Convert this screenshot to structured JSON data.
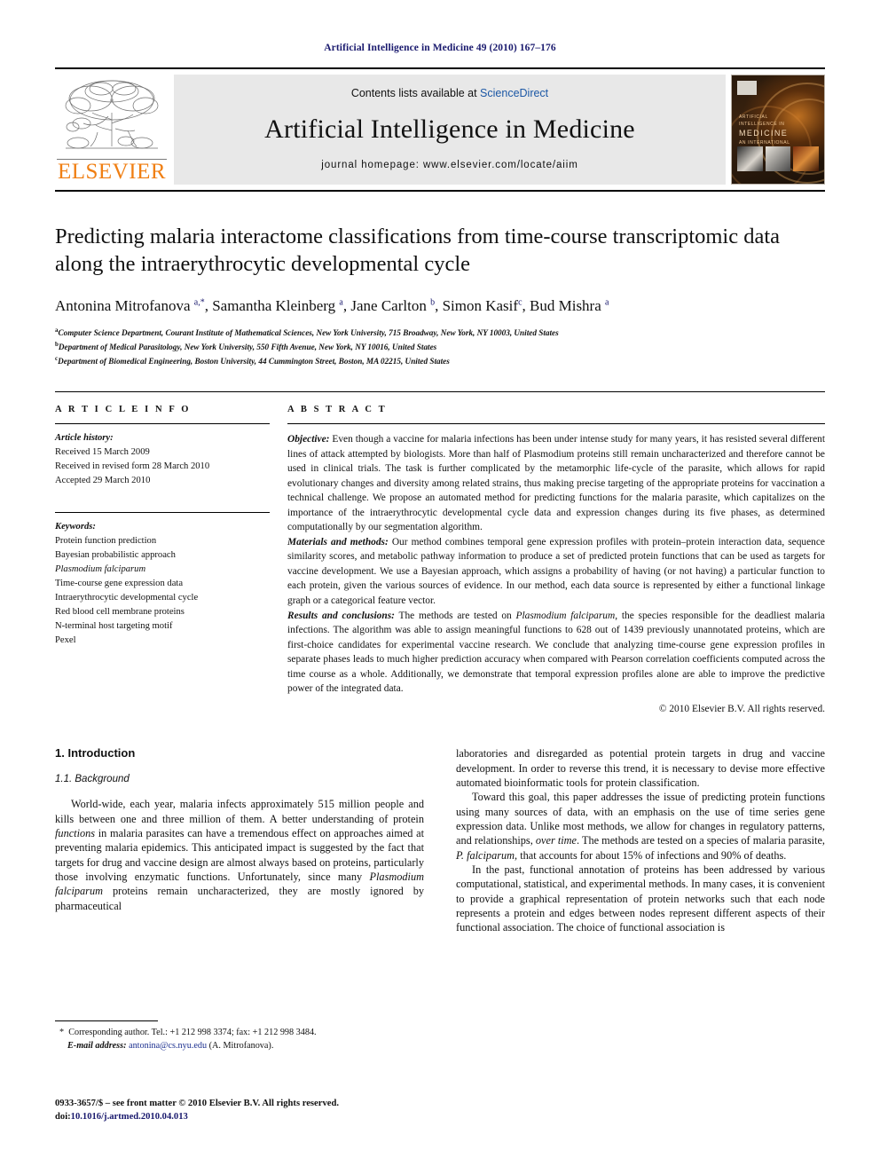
{
  "running_head": "Artificial Intelligence in Medicine 49 (2010) 167–176",
  "masthead": {
    "contents_prefix": "Contents lists available at ",
    "sciencedirect": "ScienceDirect",
    "journal_name": "Artificial Intelligence in Medicine",
    "homepage": "journal homepage: www.elsevier.com/locate/aiim",
    "publisher_wordmark": "ELSEVIER",
    "cover_title_small": "ARTIFICIAL INTELLIGENCE IN",
    "cover_title_large": "MEDICINE",
    "cover_subtitle": "AN INTERNATIONAL JOURNAL"
  },
  "article": {
    "title": "Predicting malaria interactome classifications from time-course transcriptomic data along the intraerythrocytic developmental cycle",
    "authors_html": "Antonina Mitrofanova <sup>a,*</sup>, Samantha Kleinberg <sup>a</sup>, Jane Carlton <sup>b</sup>, Simon Kasif<sup>c</sup>, Bud Mishra <sup>a</sup>",
    "affiliations": [
      "Computer Science Department, Courant Institute of Mathematical Sciences, New York University, 715 Broadway, New York, NY 10003, United States",
      "Department of Medical Parasitology, New York University, 550 Fifth Avenue, New York, NY 10016, United States",
      "Department of Biomedical Engineering, Boston University, 44 Cummington Street, Boston, MA 02215, United States"
    ],
    "affiliation_marks": [
      "a",
      "b",
      "c"
    ]
  },
  "article_info": {
    "heading": "A R T I C L E  I N F O",
    "history_label": "Article history:",
    "history": [
      "Received 15 March 2009",
      "Received in revised form 28 March 2010",
      "Accepted 29 March 2010"
    ],
    "keywords_label": "Keywords:",
    "keywords": [
      "Protein function prediction",
      "Bayesian probabilistic approach",
      "Plasmodium falciparum",
      "Time-course gene expression data",
      "Intraerythrocytic developmental cycle",
      "Red blood cell membrane proteins",
      "N-terminal host targeting motif",
      "Pexel"
    ],
    "keyword_italic_index": 2
  },
  "abstract": {
    "heading": "A B S T R A C T",
    "objective_label": "Objective:",
    "objective_text": "Even though a vaccine for malaria infections has been under intense study for many years, it has resisted several different lines of attack attempted by biologists. More than half of Plasmodium proteins still remain uncharacterized and therefore cannot be used in clinical trials. The task is further complicated by the metamorphic life-cycle of the parasite, which allows for rapid evolutionary changes and diversity among related strains, thus making precise targeting of the appropriate proteins for vaccination a technical challenge. We propose an automated method for predicting functions for the malaria parasite, which capitalizes on the importance of the intraerythrocytic developmental cycle data and expression changes during its five phases, as determined computationally by our segmentation algorithm.",
    "materials_label": "Materials and methods:",
    "materials_text": "Our method combines temporal gene expression profiles with protein–protein interaction data, sequence similarity scores, and metabolic pathway information to produce a set of predicted protein functions that can be used as targets for vaccine development. We use a Bayesian approach, which assigns a probability of having (or not having) a particular function to each protein, given the various sources of evidence. In our method, each data source is represented by either a functional linkage graph or a categorical feature vector.",
    "results_label": "Results and conclusions:",
    "results_text_1": "The methods are tested on ",
    "results_italic": "Plasmodium falciparum",
    "results_text_2": ", the species responsible for the deadliest malaria infections. The algorithm was able to assign meaningful functions to 628 out of 1439 previously unannotated proteins, which are first-choice candidates for experimental vaccine research. We conclude that analyzing time-course gene expression profiles in separate phases leads to much higher prediction accuracy when compared with Pearson correlation coefficients computed across the time course as a whole. Additionally, we demonstrate that temporal expression profiles alone are able to improve the predictive power of the integrated data.",
    "copyright": "© 2010 Elsevier B.V. All rights reserved."
  },
  "body": {
    "section_heading": "1. Introduction",
    "subsection_heading": "1.1. Background",
    "left_p1_a": "World-wide, each year, malaria infects approximately 515 million people and kills between one and three million of them. A better understanding of protein ",
    "left_p1_italic1": "functions",
    "left_p1_b": " in malaria parasites can have a tremendous effect on approaches aimed at preventing malaria epidemics. This anticipated impact is suggested by the fact that targets for drug and vaccine design are almost always based on proteins, particularly those involving enzymatic functions. Unfortunately, since many ",
    "left_p1_italic2": "Plasmodium falciparum",
    "left_p1_c": " proteins remain uncharacterized, they are mostly ignored by pharmaceutical",
    "right_p1": "laboratories and disregarded as potential protein targets in drug and vaccine development. In order to reverse this trend, it is necessary to devise more effective automated bioinformatic tools for protein classification.",
    "right_p2_a": "Toward this goal, this paper addresses the issue of predicting protein functions using many sources of data, with an emphasis on the use of time series gene expression data. Unlike most methods, we allow for changes in regulatory patterns, and relationships, ",
    "right_p2_italic1": "over time",
    "right_p2_b": ". The methods are tested on a species of malaria parasite, ",
    "right_p2_italic2": "P. falciparum",
    "right_p2_c": ", that accounts for about 15% of infections and 90% of deaths.",
    "right_p3": "In the past, functional annotation of proteins has been addressed by various computational, statistical, and experimental methods. In many cases, it is convenient to provide a graphical representation of protein networks such that each node represents a protein and edges between nodes represent different aspects of their functional association. The choice of functional association is"
  },
  "footnote": {
    "corresponding": "Corresponding author. Tel.: +1 212 998 3374; fax: +1 212 998 3484.",
    "email_label": "E-mail address:",
    "email": "antonina@cs.nyu.edu",
    "email_suffix": " (A. Mitrofanova)."
  },
  "footer": {
    "issn_line": "0933-3657/$ – see front matter © 2010 Elsevier B.V. All rights reserved.",
    "doi_prefix": "doi:",
    "doi": "10.1016/j.artmed.2010.04.013"
  },
  "colors": {
    "link_blue": "#1b57a5",
    "running_head": "#1a1a6e",
    "elsevier_orange": "#f07f13",
    "mail_blue": "#1b2f8f"
  }
}
